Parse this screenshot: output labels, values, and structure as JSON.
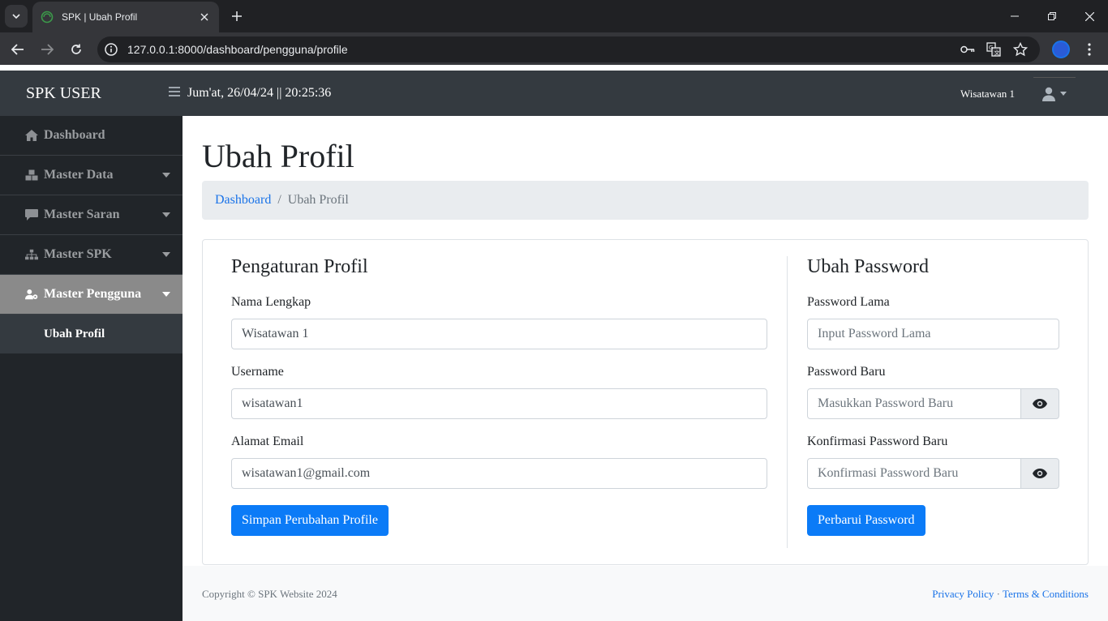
{
  "browser": {
    "tab_title": "SPK | Ubah Profil",
    "url": "127.0.0.1:8000/dashboard/pengguna/profile"
  },
  "topnav": {
    "brand": "SPK USER",
    "datetime": "Jum'at, 26/04/24 || 20:25:36",
    "username": "Wisatawan 1"
  },
  "sidebar": {
    "items": [
      {
        "label": "Dashboard",
        "icon": "home-icon"
      },
      {
        "label": "Master Data",
        "icon": "cubes-icon"
      },
      {
        "label": "Master Saran",
        "icon": "comment-icon"
      },
      {
        "label": "Master SPK",
        "icon": "sitemap-icon"
      },
      {
        "label": "Master Pengguna",
        "icon": "user-cog-icon"
      }
    ],
    "subitem": "Ubah Profil"
  },
  "page": {
    "title": "Ubah Profil",
    "breadcrumb": {
      "home": "Dashboard",
      "separator": "/",
      "current": "Ubah Profil"
    }
  },
  "profile": {
    "title": "Pengaturan Profil",
    "name_label": "Nama Lengkap",
    "name_value": "Wisatawan 1",
    "username_label": "Username",
    "username_value": "wisatawan1",
    "email_label": "Alamat Email",
    "email_value": "wisatawan1@gmail.com",
    "save_button": "Simpan Perubahan Profile"
  },
  "password": {
    "title": "Ubah Password",
    "old_label": "Password Lama",
    "old_placeholder": "Input Password Lama",
    "new_label": "Password Baru",
    "new_placeholder": "Masukkan Password Baru",
    "confirm_label": "Konfirmasi Password Baru",
    "confirm_placeholder": "Konfirmasi Password Baru",
    "update_button": "Perbarui Password"
  },
  "footer": {
    "copyright": "Copyright © SPK Website 2024",
    "privacy": "Privacy Policy",
    "dot": "·",
    "terms": "Terms & Conditions"
  }
}
